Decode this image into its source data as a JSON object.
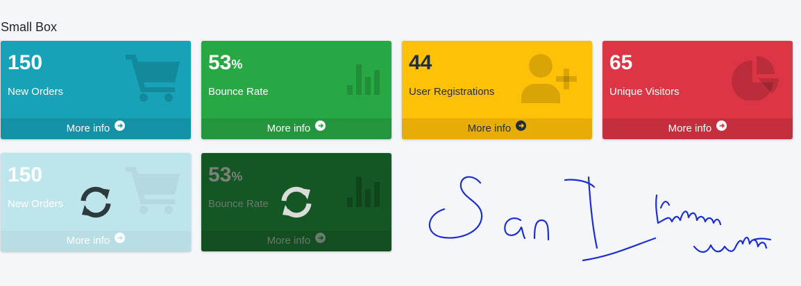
{
  "section_title": "Small Box",
  "footer_label": "More info",
  "boxes": [
    {
      "value": "150",
      "suffix": "",
      "label": "New Orders",
      "color": "#17a2b8",
      "icon": "shopping-cart-icon"
    },
    {
      "value": "53",
      "suffix": "%",
      "label": "Bounce Rate",
      "color": "#28a745",
      "icon": "bar-chart-icon"
    },
    {
      "value": "44",
      "suffix": "",
      "label": "User Registrations",
      "color": "#ffc107",
      "icon": "user-plus-icon"
    },
    {
      "value": "65",
      "suffix": "",
      "label": "Unique Visitors",
      "color": "#dc3545",
      "icon": "pie-chart-icon"
    }
  ],
  "loading_boxes": [
    {
      "value": "150",
      "suffix": "",
      "label": "New Orders",
      "color": "#bee5eb",
      "icon": "shopping-cart-icon",
      "overlay_icon": "sync-icon"
    },
    {
      "value": "53",
      "suffix": "%",
      "label": "Bounce Rate",
      "color": "#155724",
      "icon": "bar-chart-icon",
      "overlay_icon": "sync-icon"
    }
  ]
}
